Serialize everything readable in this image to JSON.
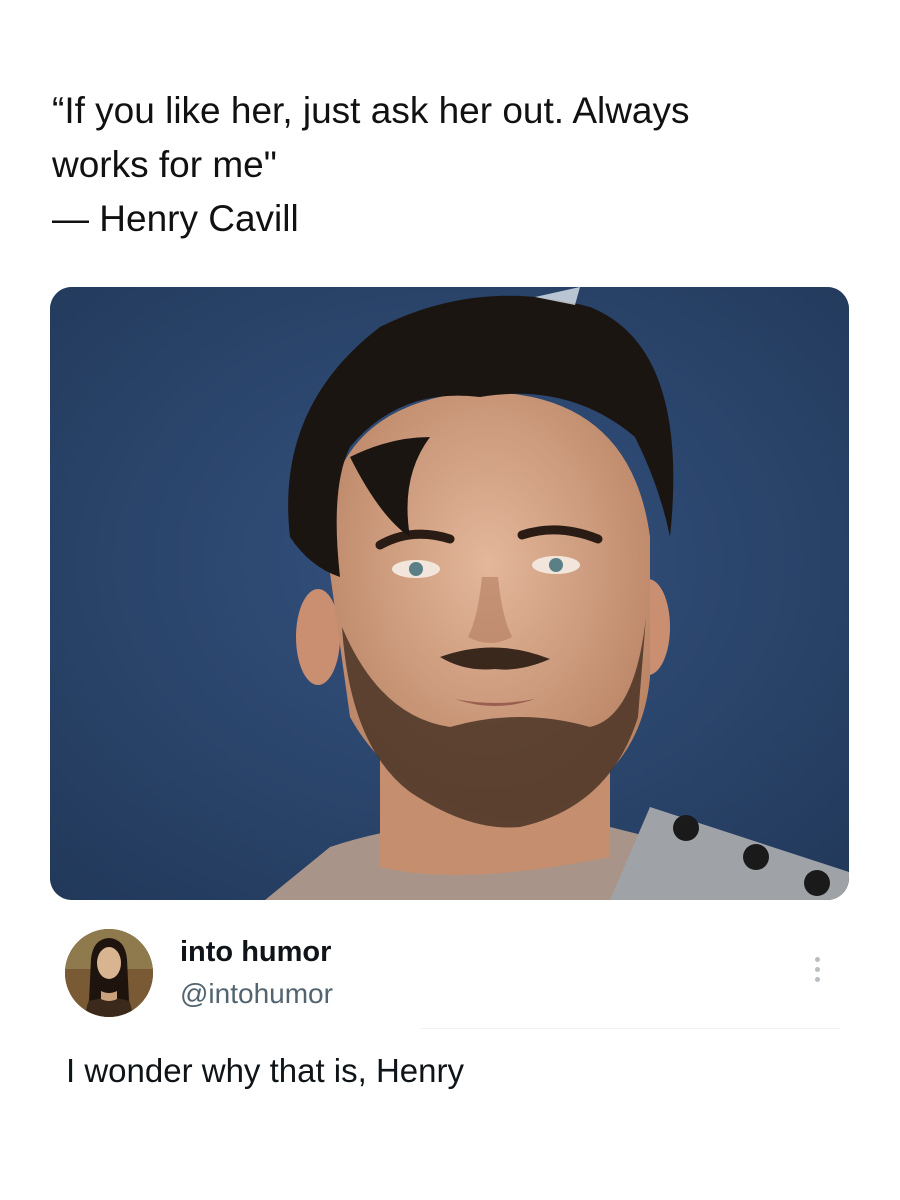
{
  "quote": {
    "line1": "“If you like her, just ask her out. Always",
    "line2": "works for me\"",
    "line3": "— Henry Cavill"
  },
  "media": {
    "icon": "portrait-photo"
  },
  "author": {
    "display_name": "into humor",
    "handle": "@intohumor",
    "avatar_icon": "painting-portrait-avatar"
  },
  "post": {
    "text": "I wonder why that is, Henry"
  },
  "colors": {
    "photo_background": "#2c4670",
    "text_primary": "#0f1419",
    "text_secondary": "#536471"
  }
}
